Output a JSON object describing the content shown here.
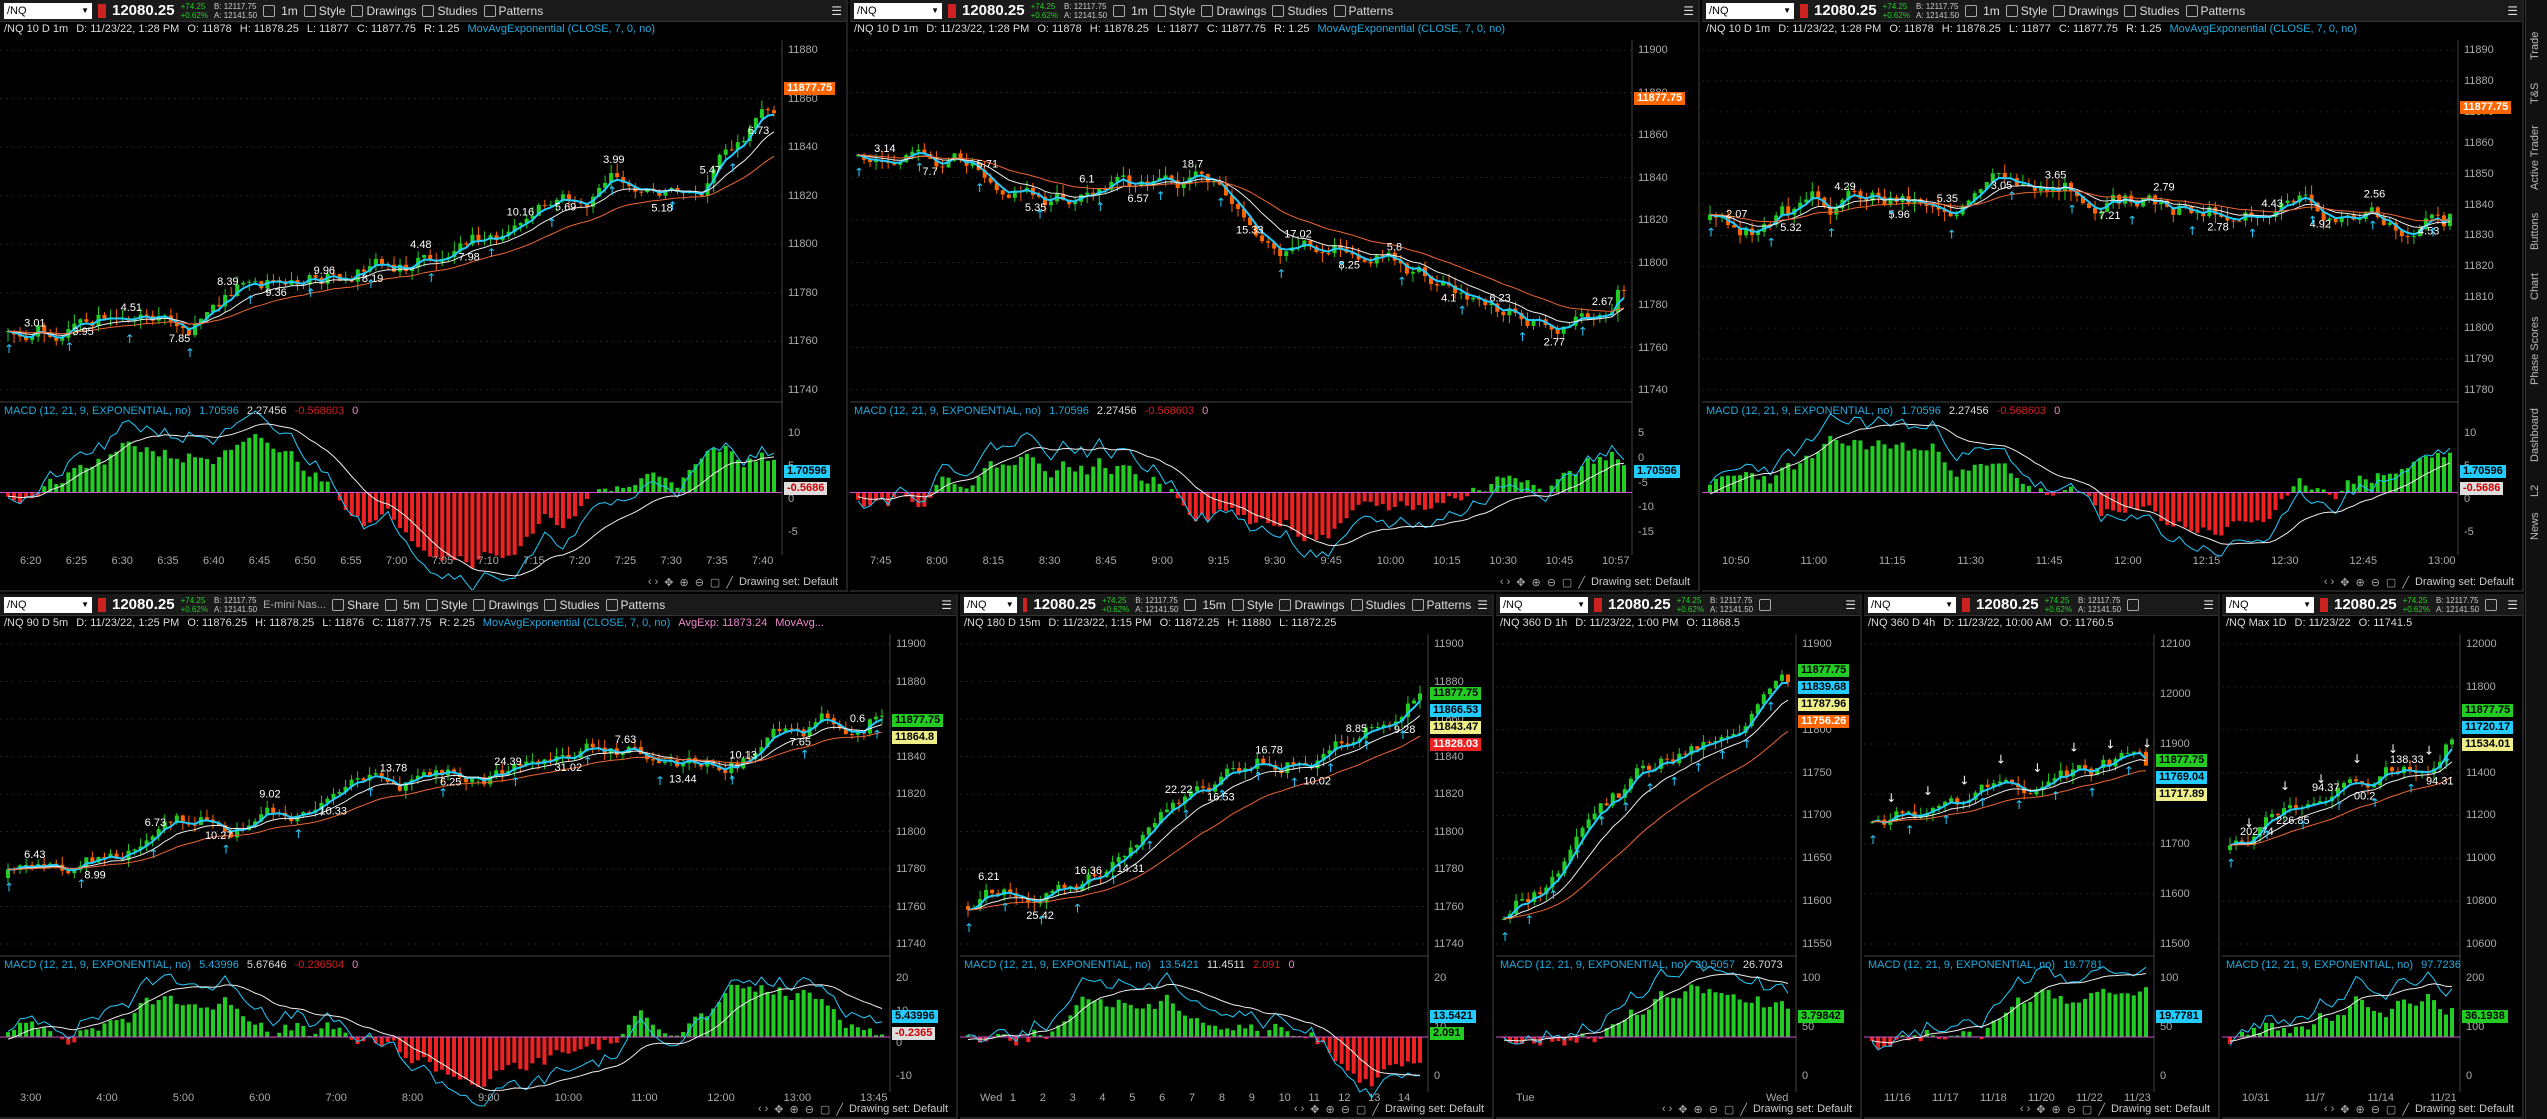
{
  "toolbar": {
    "style": "Style",
    "drawings": "Drawings",
    "studies": "Studies",
    "patterns": "Patterns",
    "share": "Share",
    "change_up": "+74.25",
    "change_pct": "+0.62%",
    "bid": "B: 12117.75",
    "ask": "A: 12141.50"
  },
  "panels": [
    {
      "id": "p1",
      "symbol": "/NQ",
      "price": "12080.25",
      "agg": "1m",
      "title": "/NQ 10 D 1m",
      "info": [
        "D: 11/23/22, 1:28 PM",
        "O: 11878",
        "H: 11878.25",
        "L: 11877",
        "C: 11877.75",
        "R: 1.25"
      ],
      "study": "MovAvgExponential (CLOSE, 7, 0, no)",
      "macd": "MACD (12, 21, 9, EXPONENTIAL, no)",
      "macd_vals": [
        "1.70596",
        "2.27456",
        "-0.568603",
        "0"
      ],
      "yticks": [
        "11880",
        "11860",
        "11840",
        "11820",
        "11800",
        "11780",
        "11760",
        "11740"
      ],
      "macd_ticks": [
        "10",
        "5",
        "0",
        "-5"
      ],
      "xticks": [
        "6:20",
        "6:25",
        "6:30",
        "6:35",
        "6:40",
        "6:45",
        "6:50",
        "6:55",
        "7:00",
        "7:05",
        "7:10",
        "7:15",
        "7:20",
        "7:25",
        "7:30",
        "7:35",
        "7:40"
      ],
      "price_tag": "11877.75",
      "macd_tags": [
        "1.70596",
        "-0.5686"
      ],
      "annotations": [
        "3.01",
        "3.95",
        "4.51",
        "7.85",
        "8.39",
        "9.36",
        "9.96",
        "8.19",
        "4.48",
        "7.98",
        "10.16",
        "5.69",
        "3.99",
        "5.18",
        "5.47",
        "6.73"
      ],
      "drawing_set": "Drawing set: Default"
    },
    {
      "id": "p2",
      "symbol": "/NQ",
      "price": "12080.25",
      "agg": "1m",
      "title": "/NQ 10 D 1m",
      "info": [
        "D: 11/23/22, 1:28 PM",
        "O: 11878",
        "H: 11878.25",
        "L: 11877",
        "C: 11877.75",
        "R: 1.25"
      ],
      "study": "MovAvgExponential (CLOSE, 7, 0, no)",
      "macd": "MACD (12, 21, 9, EXPONENTIAL, no)",
      "macd_vals": [
        "1.70596",
        "2.27456",
        "-0.568603",
        "0"
      ],
      "yticks": [
        "11900",
        "11880",
        "11860",
        "11840",
        "11820",
        "11800",
        "11780",
        "11760",
        "11740"
      ],
      "macd_ticks": [
        "5",
        "0",
        "-5",
        "-10",
        "-15"
      ],
      "xticks": [
        "7:45",
        "8:00",
        "8:15",
        "8:30",
        "8:45",
        "9:00",
        "9:15",
        "9:30",
        "9:45",
        "10:00",
        "10:15",
        "10:30",
        "10:45",
        "10:57"
      ],
      "price_tag": "11877.75",
      "macd_tags": [
        "1.70596"
      ],
      "annotations": [
        "3.14",
        "7.7",
        "5.71",
        "5.35",
        "6.1",
        "6.57",
        "18.7",
        "15.33",
        "17.02",
        "8.25",
        "5.8",
        "4.1",
        "6.23",
        "2.77",
        "2.67"
      ],
      "drawing_set": "Drawing set: Default"
    },
    {
      "id": "p3",
      "symbol": "/NQ",
      "price": "12080.25",
      "agg": "1m",
      "title": "/NQ 10 D 1m",
      "info": [
        "D: 11/23/22, 1:28 PM",
        "O: 11878",
        "H: 11878.25",
        "L: 11877",
        "C: 11877.75",
        "R: 1.25"
      ],
      "study": "MovAvgExponential (CLOSE, 7, 0, no)",
      "macd": "MACD (12, 21, 9, EXPONENTIAL, no)",
      "macd_vals": [
        "1.70596",
        "2.27456",
        "-0.568603",
        "0"
      ],
      "yticks": [
        "11890",
        "11880",
        "11870",
        "11860",
        "11850",
        "11840",
        "11830",
        "11820",
        "11810",
        "11800",
        "11790",
        "11780"
      ],
      "macd_ticks": [
        "10",
        "5",
        "0",
        "-5"
      ],
      "xticks": [
        "10:50",
        "11:00",
        "11:15",
        "11:30",
        "11:45",
        "12:00",
        "12:15",
        "12:30",
        "12:45",
        "13:00"
      ],
      "price_tag": "11877.75",
      "macd_tags": [
        "1.70596",
        "-0.5686"
      ],
      "annotations": [
        "2.07",
        "5.32",
        "4.29",
        "5.96",
        "5.35",
        "3.05",
        "3.65",
        "7.21",
        "2.79",
        "2.78",
        "4.43",
        "4.92",
        "2.56",
        "4.53"
      ],
      "drawing_set": "Drawing set: Default"
    },
    {
      "id": "p4",
      "symbol": "/NQ",
      "price": "12080.25",
      "agg": "5m",
      "title": "/NQ 90 D 5m",
      "desc": "E-mini Nas...",
      "info": [
        "D: 11/23/22, 1:25 PM",
        "O: 11876.25",
        "H: 11878.25",
        "L: 11876",
        "C: 11877.75",
        "R: 2.25"
      ],
      "study": "MovAvgExponential (CLOSE, 7, 0, no)",
      "study2": "AvgExp: 11873.24",
      "study3": "MovAvg...",
      "macd": "MACD (12, 21, 9, EXPONENTIAL, no)",
      "macd_vals": [
        "5.43996",
        "5.67646",
        "-0.236504",
        "0"
      ],
      "yticks": [
        "11900",
        "11880",
        "11860",
        "11840",
        "11820",
        "11800",
        "11780",
        "11760",
        "11740"
      ],
      "macd_ticks": [
        "20",
        "10",
        "0",
        "-10"
      ],
      "xticks": [
        "3:00",
        "4:00",
        "5:00",
        "6:00",
        "7:00",
        "8:00",
        "9:00",
        "10:00",
        "11:00",
        "12:00",
        "13:00",
        "13:45"
      ],
      "price_tags": [
        "11877.75",
        "11864.8"
      ],
      "macd_tags": [
        "5.43996",
        "-0.2365"
      ],
      "annotations": [
        "6.43",
        "8.99",
        "6.73",
        "10.27",
        "9.02",
        "10.33",
        "13.78",
        "6.25",
        "24.39",
        "31.02",
        "7.63",
        "13.44",
        "10.13",
        "7.65",
        "0.6"
      ],
      "drawing_set": "Drawing set: Default"
    },
    {
      "id": "p5",
      "symbol": "/NQ",
      "price": "12080.25",
      "agg": "15m",
      "title": "/NQ 180 D 15m",
      "info": [
        "D: 11/23/22, 1:15 PM",
        "O: 11872.25",
        "H: 11880",
        "L: 11872.25"
      ],
      "macd": "MACD (12, 21, 9, EXPONENTIAL, no)",
      "macd_vals": [
        "13.5421",
        "11.4511",
        "2.091",
        "0"
      ],
      "yticks": [
        "11900",
        "11880",
        "11860",
        "11840",
        "11820",
        "11800",
        "11780",
        "11760",
        "11740"
      ],
      "macd_ticks": [
        "20",
        "10",
        "0"
      ],
      "xticks": [
        "Wed",
        "1",
        "2",
        "3",
        "4",
        "5",
        "6",
        "7",
        "8",
        "9",
        "10",
        "11",
        "12",
        "13",
        "14"
      ],
      "price_tags": [
        "11877.75",
        "11866.53",
        "11843.47",
        "11828.03"
      ],
      "macd_tags": [
        "13.5421",
        "2.091"
      ],
      "annotations": [
        "6.21",
        "25.42",
        "16.36",
        "14.31",
        "22.22",
        "16.53",
        "16.78",
        "10.02",
        "8.85",
        "9.28"
      ],
      "drawing_set": "Drawing set: Default"
    },
    {
      "id": "p6",
      "symbol": "/NQ",
      "price": "12080.25",
      "agg": "",
      "title": "/NQ 360 D 1h",
      "info": [
        "D: 11/23/22, 1:00 PM",
        "O: 11868.5"
      ],
      "macd": "MACD (12, 21, 9, EXPONENTIAL, no)",
      "macd_vals": [
        "30.5057",
        "26.7073"
      ],
      "yticks": [
        "11900",
        "11850",
        "11800",
        "11750",
        "11700",
        "11650",
        "11600",
        "11550"
      ],
      "macd_ticks": [
        "100",
        "50",
        "0"
      ],
      "xticks": [
        "Tue",
        "Wed"
      ],
      "price_tags": [
        "11877.75",
        "11839.68",
        "11787.96",
        "11756.26"
      ],
      "macd_tags": [
        "3.79842"
      ],
      "drawing_set": "Drawing set: Default"
    },
    {
      "id": "p7",
      "symbol": "/NQ",
      "price": "12080.25",
      "agg": "",
      "title": "/NQ 360 D 4h",
      "info": [
        "D: 11/23/22, 10:00 AM",
        "O: 11760.5"
      ],
      "macd": "MACD (12, 21, 9, EXPONENTIAL, no)",
      "macd_vals": [
        "19.7781"
      ],
      "yticks": [
        "12100",
        "12000",
        "11900",
        "11800",
        "11700",
        "11600",
        "11500"
      ],
      "macd_ticks": [
        "100",
        "50",
        "0"
      ],
      "xticks": [
        "11/16",
        "11/17",
        "11/18",
        "11/20",
        "11/22",
        "11/23"
      ],
      "price_tags": [
        "11877.75",
        "11769.04",
        "11717.89"
      ],
      "macd_tags": [
        "19.7781"
      ],
      "drawing_set": "Drawing set: Default"
    },
    {
      "id": "p8",
      "symbol": "/NQ",
      "price": "12080.25",
      "agg": "",
      "title": "/NQ Max 1D",
      "info": [
        "D: 11/23/22",
        "O: 11741.5"
      ],
      "macd": "MACD (12, 21, 9, EXPONENTIAL, no)",
      "macd_vals": [
        "97.7236"
      ],
      "yticks": [
        "12000",
        "11800",
        "11600",
        "11400",
        "11200",
        "11000",
        "10800",
        "10600"
      ],
      "macd_ticks": [
        "200",
        "100",
        "0"
      ],
      "xticks": [
        "10/31",
        "11/7",
        "11/14",
        "11/21"
      ],
      "price_tags": [
        "11877.75",
        "11720.17",
        "11534.01"
      ],
      "macd_tags": [
        "36.1938"
      ],
      "annotations": [
        "202.74",
        "226.85",
        "94.37",
        "00.2",
        "138.33",
        "94.31"
      ],
      "drawing_set": "Drawing set: Default"
    }
  ],
  "sidebar": [
    "Trade",
    "T&S",
    "Active Trader",
    "Buttons",
    "Chart",
    "Phase Scores",
    "Dashboard",
    "L2",
    "News"
  ],
  "colors": {
    "up": "#2c2",
    "down": "#f60",
    "ema_fast": "#2cf",
    "ema_mid": "#eee",
    "ema_slow": "#e63",
    "macd_pos": "#2c2",
    "macd_neg": "#e22",
    "accent": "#2ad"
  }
}
